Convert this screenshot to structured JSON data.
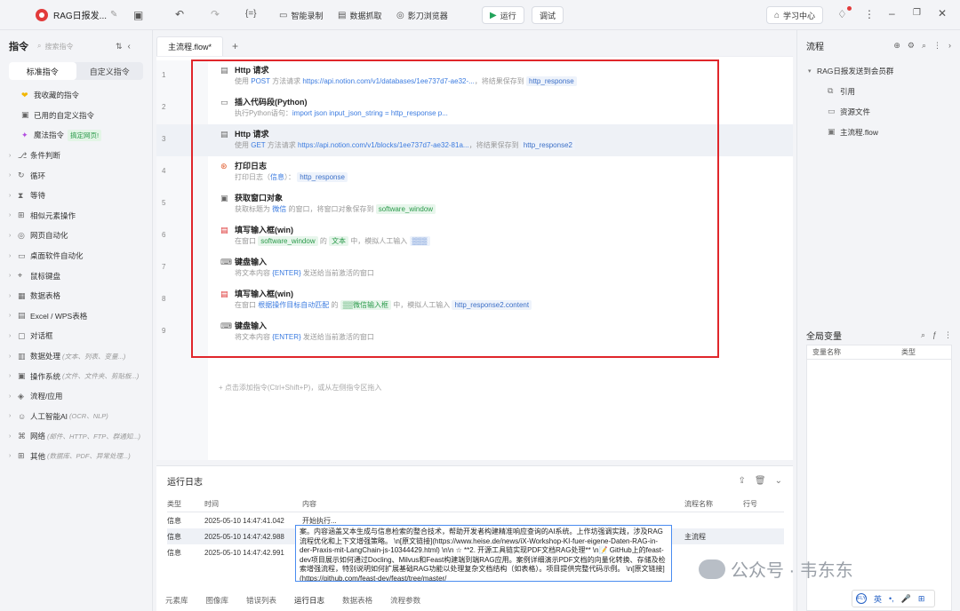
{
  "topbar": {
    "title": "RAG日报发...",
    "buttons": {
      "smart_record": "智能录制",
      "data_capture": "数据抓取",
      "browser": "影刀浏览器",
      "run": "运行",
      "debug": "调试",
      "learn": "学习中心"
    }
  },
  "sidebar": {
    "title": "指令",
    "search_placeholder": "搜索指令",
    "tabs": [
      "标准指令",
      "自定义指令"
    ],
    "specials": [
      {
        "label": "我收藏的指令",
        "icon": "heart-icon"
      },
      {
        "label": "已用的自定义指令",
        "icon": "box-icon"
      },
      {
        "label": "魔法指令",
        "icon": "sparkle-icon",
        "badge": "搞定网页!"
      }
    ],
    "items": [
      {
        "label": "条件判断",
        "hint": ""
      },
      {
        "label": "循环",
        "hint": ""
      },
      {
        "label": "等待",
        "hint": ""
      },
      {
        "label": "相似元素操作",
        "hint": ""
      },
      {
        "label": "网页自动化",
        "hint": ""
      },
      {
        "label": "桌面软件自动化",
        "hint": ""
      },
      {
        "label": "鼠标键盘",
        "hint": ""
      },
      {
        "label": "数据表格",
        "hint": ""
      },
      {
        "label": "Excel / WPS表格",
        "hint": ""
      },
      {
        "label": "对话框",
        "hint": ""
      },
      {
        "label": "数据处理",
        "hint": "(文本、列表、变量...)"
      },
      {
        "label": "操作系统",
        "hint": "(文件、文件夹、剪贴板...)"
      },
      {
        "label": "流程/应用",
        "hint": ""
      },
      {
        "label": "人工智能AI",
        "hint": "(OCR、NLP)"
      },
      {
        "label": "网络",
        "hint": "(邮件、HTTP、FTP、群通知...)"
      },
      {
        "label": "其他",
        "hint": "(数据库、PDF、异常处理...)"
      }
    ]
  },
  "editor": {
    "tab": "主流程.flow*",
    "add_hint": "+ 点击添加指令(Ctrl+Shift+P)，或从左侧指令区拖入",
    "rows": [
      {
        "num": "1",
        "title": "Http 请求",
        "desc_a": "使用 ",
        "k1": "POST",
        "desc_b": " 方法请求 ",
        "k2": "https://api.notion.com/v1/databases/1ee737d7-ae32-...",
        "desc_c": "，将结果保存到 ",
        "chip": "http_response"
      },
      {
        "num": "2",
        "title": "插入代码段(Python)",
        "desc_a": "执行Python语句：",
        "k1": "import json   input_json_string = http_response   p...",
        "desc_b": "",
        "k2": "",
        "desc_c": "",
        "chip": ""
      },
      {
        "num": "3",
        "title": "Http 请求",
        "desc_a": "使用 ",
        "k1": "GET",
        "desc_b": " 方法请求 ",
        "k2": "https://api.notion.com/v1/blocks/1ee737d7-ae32-81a...",
        "desc_c": "，将结果保存到 ",
        "chip": "http_response2"
      },
      {
        "num": "4",
        "title": "打印日志",
        "desc_a": "打印日志（",
        "k1": "信息",
        "desc_b": "）：",
        "k2": "",
        "desc_c": "",
        "chip": "http_response"
      },
      {
        "num": "5",
        "title": "获取窗口对象",
        "desc_a": "获取标题为 ",
        "k1": "微信",
        "desc_b": " 的窗口，将窗口对象保存到 ",
        "k2": "",
        "desc_c": "",
        "chip": "software_window"
      },
      {
        "num": "6",
        "title": "填写输入框(win)",
        "desc_a": "在窗口 ",
        "k1": "software_window",
        "desc_b": " 的 ",
        "k2": "文本",
        "desc_c": " 中，模拟人工输入 ",
        "chip": "▒▒▒"
      },
      {
        "num": "7",
        "title": "键盘输入",
        "desc_a": "将文本内容 ",
        "k1": "{ENTER}",
        "desc_b": " 发送给当前激活的窗口",
        "k2": "",
        "desc_c": "",
        "chip": ""
      },
      {
        "num": "8",
        "title": "填写输入框(win)",
        "desc_a": "在窗口 ",
        "k1": "根据操作目标自动匹配",
        "desc_b": " 的 ",
        "k2": "▒▒微信输入框",
        "desc_c": " 中，模拟人工输入 ",
        "chip": "http_response2.content"
      },
      {
        "num": "9",
        "title": "键盘输入",
        "desc_a": "将文本内容 ",
        "k1": "{ENTER}",
        "desc_b": " 发送给当前激活的窗口",
        "k2": "",
        "desc_c": "",
        "chip": ""
      }
    ]
  },
  "log": {
    "title": "运行日志",
    "headers": [
      "类型",
      "时间",
      "内容",
      "流程名称",
      "行号"
    ],
    "rows": [
      {
        "type": "信息",
        "time": "2025-05-10 14:47:41.042",
        "content": "开始执行...",
        "flow": "",
        "line": ""
      },
      {
        "type": "信息",
        "time": "2025-05-10 14:47:42.988",
        "content": "",
        "flow": "主流程",
        "line": ""
      },
      {
        "type": "信息",
        "time": "2025-05-10 14:47:42.991",
        "content": "",
        "flow": "",
        "line": ""
      }
    ],
    "expanded_content": "案。内容涵盖又本生成与信息检索的整合技术，帮助开发者构建精准响应查询的AI系统。上作坊强调实践，涉及RAG流程优化和上下文增强策略。 \\n[原文链接](https://www.heise.de/news/iX-Workshop-KI-fuer-eigene-Daten-RAG-in-der-Praxis-mit-LangChain-js-10344429.html) \\n\\n ☆ **2. 开源工具链实现PDF文档RAG处理** \\n📝 GitHub上的feast-dev项目展示如何通过Docling、Milvus和Feast构建端到端RAG应用。案例详细演示PDF文档的向量化转换、存储及检索增强流程，特别说明如何扩展基础RAG功能以处理复杂文档结构（如表格）。项目提供完整代码示例。 \\n[原文链接](https://github.com/feast-dev/feast/tree/master/",
    "bottom_tabs": [
      "元素库",
      "图像库",
      "错误列表",
      "运行日志",
      "数据表格",
      "流程参数"
    ]
  },
  "rpanel": {
    "title": "流程",
    "tree": [
      {
        "label": "RAG日报发送到会员群",
        "icon": "caret-down-icon",
        "indent": 0
      },
      {
        "label": "引用",
        "icon": "reference-icon",
        "indent": 1
      },
      {
        "label": "资源文件",
        "icon": "folder-icon",
        "indent": 1
      },
      {
        "label": "主流程.flow",
        "icon": "flow-icon",
        "indent": 1
      }
    ],
    "global_vars": {
      "title": "全局变量",
      "headers": [
        "变量名称",
        "类型"
      ]
    }
  },
  "watermark": {
    "text": "公众号 · 韦东东"
  },
  "ime": {
    "label": "英",
    "logo": "iFLY"
  }
}
